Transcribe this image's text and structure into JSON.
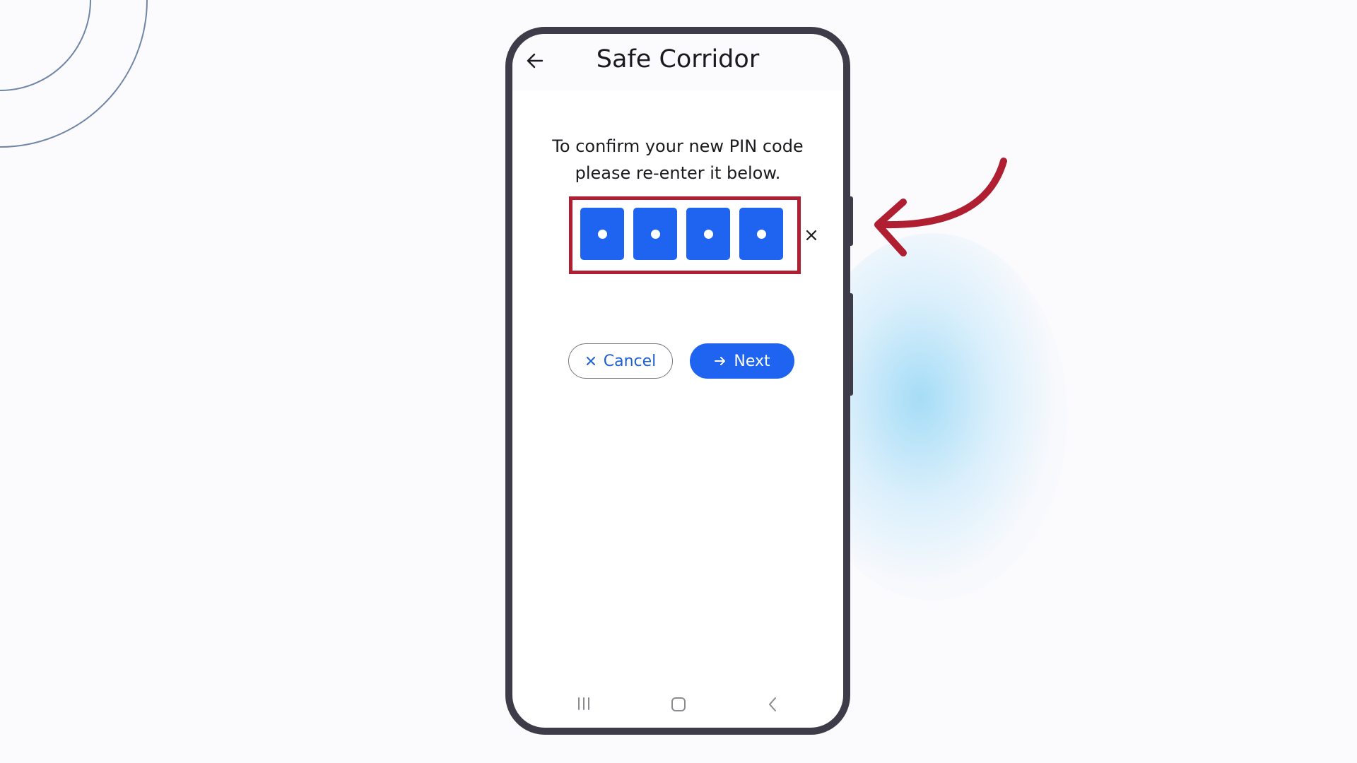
{
  "app": {
    "title": "Safe Corridor"
  },
  "prompt": {
    "line1": "To confirm your new PIN code",
    "line2": "please re-enter it below."
  },
  "pin": {
    "length": 4,
    "entered": 4,
    "mask_char": "•"
  },
  "buttons": {
    "cancel_label": "Cancel",
    "next_label": "Next"
  },
  "icons": {
    "back": "arrow-left-icon",
    "clear": "close-icon",
    "cancel": "close-icon",
    "next": "arrow-right-icon",
    "nav_recents": "recents-icon",
    "nav_home": "home-icon",
    "nav_back": "chevron-left-icon"
  },
  "colors": {
    "primary": "#1e64f0",
    "highlight": "#b01e32",
    "frame": "#3e3c48",
    "background": "#fbfafd"
  }
}
